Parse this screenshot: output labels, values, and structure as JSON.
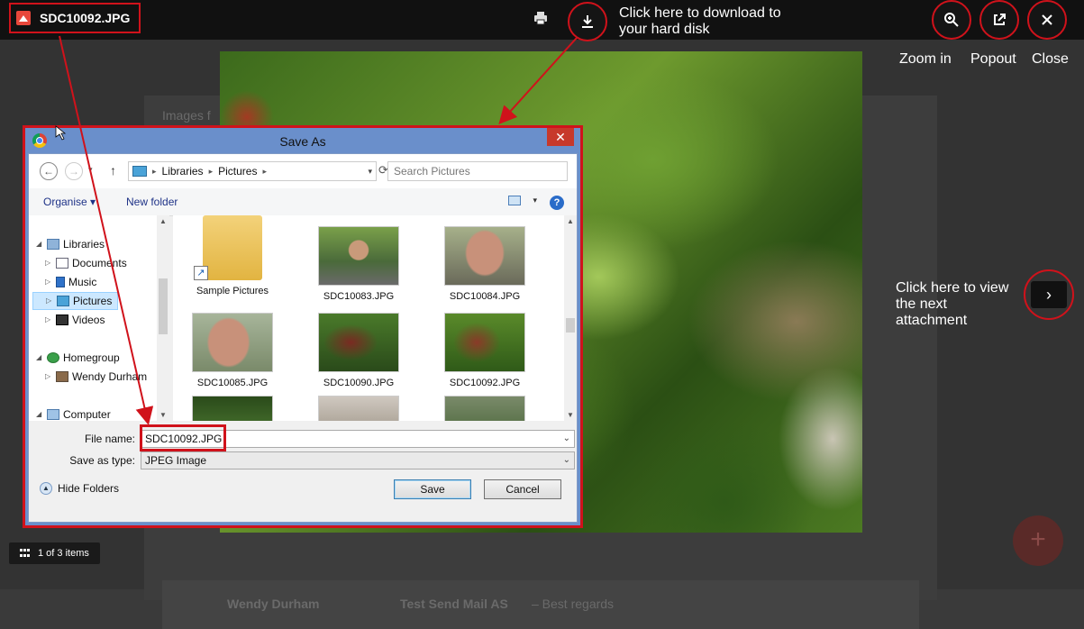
{
  "viewer": {
    "file_title": "SDC10092.JPG",
    "item_count": "1 of 3 items",
    "zoom_label": "Zoom in",
    "popout_label": "Popout",
    "close_label": "Close",
    "download_callout": "Click here to download to your hard disk",
    "next_callout": "Click here to view the next attachment"
  },
  "background": {
    "partial_text_1": "Images f",
    "sender": "Wendy Durham",
    "subject": "Test Send Mail AS",
    "snippet": "– Best regards"
  },
  "dialog": {
    "title": "Save As",
    "close_label": "✕",
    "breadcrumb": [
      "Libraries",
      "Pictures"
    ],
    "search_placeholder": "Search Pictures",
    "organise_label": "Organise ▾",
    "new_folder_label": "New folder",
    "nav": {
      "libraries": "Libraries",
      "documents": "Documents",
      "music": "Music",
      "pictures": "Pictures",
      "videos": "Videos",
      "homegroup": "Homegroup",
      "wendy": "Wendy Durham",
      "computer": "Computer"
    },
    "files": [
      {
        "name": "Sample Pictures"
      },
      {
        "name": "SDC10083.JPG"
      },
      {
        "name": "SDC10084.JPG"
      },
      {
        "name": "SDC10085.JPG"
      },
      {
        "name": "SDC10090.JPG"
      },
      {
        "name": "SDC10092.JPG"
      }
    ],
    "file_name_label": "File name:",
    "file_name_value": "SDC10092.JPG",
    "save_type_label": "Save as type:",
    "save_type_value": "JPEG Image",
    "hide_folders_label": "Hide Folders",
    "save_button": "Save",
    "cancel_button": "Cancel"
  },
  "colors": {
    "highlight_red": "#d0121b",
    "title_bar_blue": "#6a8fcb"
  }
}
